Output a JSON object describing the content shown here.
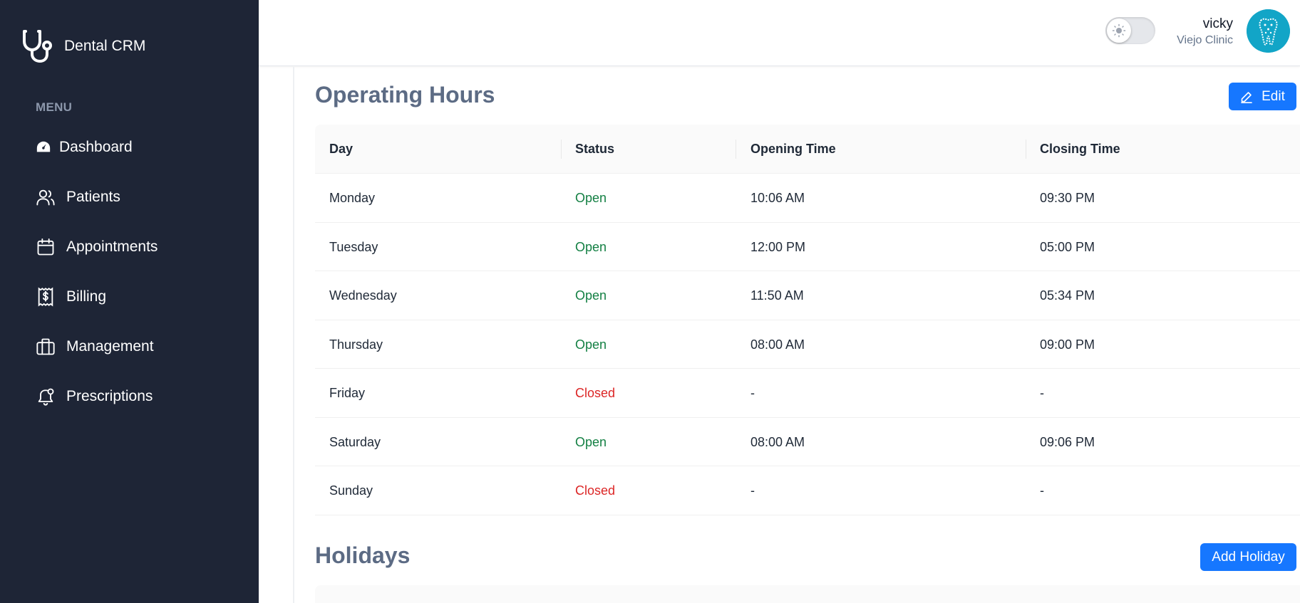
{
  "sidebar": {
    "brand": "Dental CRM",
    "menu_label": "MENU",
    "items": [
      {
        "label": "Dashboard",
        "icon": "dashboard-gauge-icon"
      },
      {
        "label": "Patients",
        "icon": "users-icon"
      },
      {
        "label": "Appointments",
        "icon": "calendar-icon"
      },
      {
        "label": "Billing",
        "icon": "receipt-dollar-icon"
      },
      {
        "label": "Management",
        "icon": "briefcase-icon"
      },
      {
        "label": "Prescriptions",
        "icon": "bell-icon"
      }
    ]
  },
  "header": {
    "user_name": "vicky",
    "clinic_name": "Viejo Clinic"
  },
  "operating_hours": {
    "title": "Operating Hours",
    "edit_label": "Edit",
    "columns": [
      "Day",
      "Status",
      "Opening Time",
      "Closing Time"
    ],
    "rows": [
      {
        "day": "Monday",
        "status": "Open",
        "open": "10:06 AM",
        "close": "09:30 PM"
      },
      {
        "day": "Tuesday",
        "status": "Open",
        "open": "12:00 PM",
        "close": "05:00 PM"
      },
      {
        "day": "Wednesday",
        "status": "Open",
        "open": "11:50 AM",
        "close": "05:34 PM"
      },
      {
        "day": "Thursday",
        "status": "Open",
        "open": "08:00 AM",
        "close": "09:00 PM"
      },
      {
        "day": "Friday",
        "status": "Closed",
        "open": "-",
        "close": "-"
      },
      {
        "day": "Saturday",
        "status": "Open",
        "open": "08:00 AM",
        "close": "09:06 PM"
      },
      {
        "day": "Sunday",
        "status": "Closed",
        "open": "-",
        "close": "-"
      }
    ]
  },
  "holidays": {
    "title": "Holidays",
    "add_label": "Add Holiday"
  },
  "colors": {
    "sidebar_bg": "#1e2536",
    "accent": "#1677ff",
    "open": "#148044",
    "closed": "#dc2626",
    "title": "#5c6b84"
  }
}
